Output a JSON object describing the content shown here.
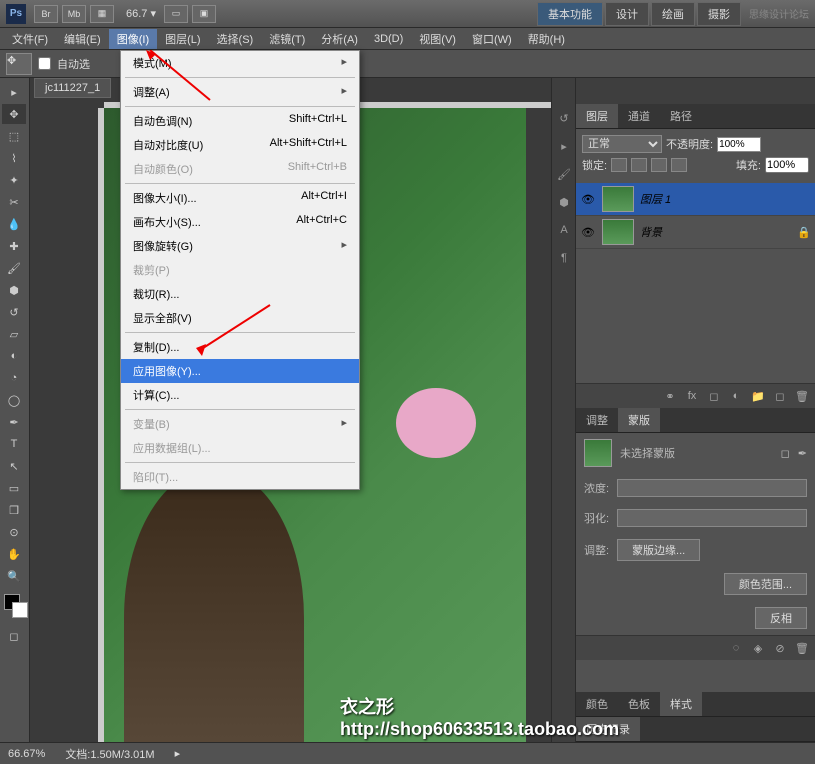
{
  "title_bar": {
    "logo": "Ps",
    "zoom": "66.7",
    "workspace_tabs": [
      "基本功能",
      "设计",
      "绘画",
      "摄影"
    ],
    "watermark": "思缘设计论坛"
  },
  "menu_bar": {
    "items": [
      "文件(F)",
      "编辑(E)",
      "图像(I)",
      "图层(L)",
      "选择(S)",
      "滤镜(T)",
      "分析(A)",
      "3D(D)",
      "视图(V)",
      "窗口(W)",
      "帮助(H)"
    ],
    "open_index": 2
  },
  "options_bar": {
    "auto_select": "自动选"
  },
  "dropdown": {
    "items": [
      {
        "label": "模式(M)",
        "shortcut": "",
        "submenu": true
      },
      {
        "sep": true
      },
      {
        "label": "调整(A)",
        "shortcut": "",
        "submenu": true
      },
      {
        "sep": true
      },
      {
        "label": "自动色调(N)",
        "shortcut": "Shift+Ctrl+L"
      },
      {
        "label": "自动对比度(U)",
        "shortcut": "Alt+Shift+Ctrl+L"
      },
      {
        "label": "自动颜色(O)",
        "shortcut": "Shift+Ctrl+B",
        "disabled": true
      },
      {
        "sep": true
      },
      {
        "label": "图像大小(I)...",
        "shortcut": "Alt+Ctrl+I"
      },
      {
        "label": "画布大小(S)...",
        "shortcut": "Alt+Ctrl+C"
      },
      {
        "label": "图像旋转(G)",
        "shortcut": "",
        "submenu": true
      },
      {
        "label": "裁剪(P)",
        "shortcut": "",
        "disabled": true
      },
      {
        "label": "裁切(R)...",
        "shortcut": ""
      },
      {
        "label": "显示全部(V)",
        "shortcut": ""
      },
      {
        "sep": true
      },
      {
        "label": "复制(D)...",
        "shortcut": ""
      },
      {
        "label": "应用图像(Y)...",
        "shortcut": "",
        "highlight": true
      },
      {
        "label": "计算(C)...",
        "shortcut": ""
      },
      {
        "sep": true
      },
      {
        "label": "变量(B)",
        "shortcut": "",
        "submenu": true,
        "disabled": true
      },
      {
        "label": "应用数据组(L)...",
        "shortcut": "",
        "disabled": true
      },
      {
        "sep": true
      },
      {
        "label": "陷印(T)...",
        "shortcut": "",
        "disabled": true
      }
    ]
  },
  "document": {
    "tab": "jc111227_1"
  },
  "layers_panel": {
    "tabs": [
      "图层",
      "通道",
      "路径"
    ],
    "blend_mode": "正常",
    "opacity_label": "不透明度:",
    "opacity": "100%",
    "lock_label": "锁定:",
    "fill_label": "填充:",
    "fill": "100%",
    "layers": [
      {
        "name": "图层 1",
        "selected": true,
        "visible": true
      },
      {
        "name": "背景",
        "selected": false,
        "visible": true,
        "locked": true
      }
    ]
  },
  "adjust_panel": {
    "tabs": [
      "调整",
      "蒙版"
    ],
    "no_mask": "未选择蒙版",
    "density_label": "浓度:",
    "feather_label": "羽化:",
    "adjust_label": "调整:",
    "buttons": [
      "蒙版边缘...",
      "颜色范围...",
      "反相"
    ]
  },
  "bottom_tabs": [
    "颜色",
    "色板",
    "样式"
  ],
  "history_tab": "历史记录",
  "status_bar": {
    "zoom": "66.67%",
    "doc_info": "文档:1.50M/3.01M"
  },
  "watermark": {
    "line1": "衣之形",
    "line2": "http://shop60633513.taobao.com"
  }
}
